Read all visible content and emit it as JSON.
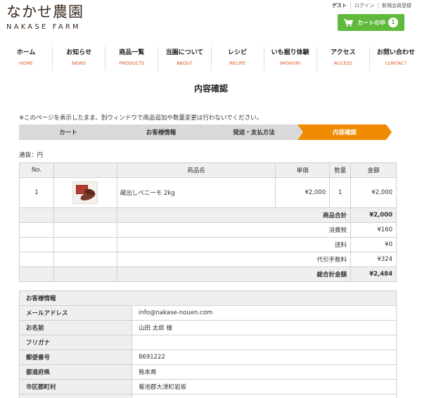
{
  "header": {
    "logo_jp": "なかせ農園",
    "logo_en": "NAKASE FARM",
    "top_links": [
      "ゲスト",
      "ログイン",
      "新規会員登録"
    ],
    "cart_label": "カートの中",
    "cart_count": "1"
  },
  "nav": [
    {
      "jp": "ホーム",
      "en": "HOME"
    },
    {
      "jp": "お知らせ",
      "en": "NEWS"
    },
    {
      "jp": "商品一覧",
      "en": "PRODUCTS"
    },
    {
      "jp": "当園について",
      "en": "ABOUT"
    },
    {
      "jp": "レシピ",
      "en": "RECIPE"
    },
    {
      "jp": "いも掘り体験",
      "en": "IMOHORI"
    },
    {
      "jp": "アクセス",
      "en": "ACCESS"
    },
    {
      "jp": "お問い合わせ",
      "en": "CONTACT"
    }
  ],
  "page_title": "内容確認",
  "notice": "※このページを表示したまま、別ウィンドウで商品追加や数量変更は行わないでください。",
  "steps": [
    "カート",
    "お客様情報",
    "発送・支払方法",
    "内容確認"
  ],
  "currency": "通貨：円",
  "items_table": {
    "headers": [
      "No.",
      "",
      "商品名",
      "単価",
      "数量",
      "金額"
    ],
    "rows": [
      {
        "no": "1",
        "name": "蔵出しベニーモ 2kg",
        "unit_price": "¥2,000",
        "qty": "1",
        "amount": "¥2,000"
      }
    ],
    "subtotal_label": "商品合計",
    "subtotal": "¥2,000",
    "tax_label": "消費税",
    "tax": "¥160",
    "shipping_label": "送料",
    "shipping": "¥0",
    "cod_label": "代引手数料",
    "cod": "¥324",
    "total_label": "総合計金額",
    "total": "¥2,484"
  },
  "customer": {
    "heading": "お客様情報",
    "fields": [
      {
        "label": "メールアドレス",
        "value": "info@nakase-nouen.com"
      },
      {
        "label": "お名前",
        "value": "山田 太郎 様"
      },
      {
        "label": "フリガナ",
        "value": ""
      },
      {
        "label": "郵便番号",
        "value": "8691222"
      },
      {
        "label": "都道府県",
        "value": "熊本県"
      },
      {
        "label": "市区郡町村",
        "value": "菊池郡大津町岩坂"
      }
    ]
  },
  "colors": {
    "accent": "#f08a00",
    "cart_green": "#5fb93c",
    "nav_en": "#e0531e"
  }
}
